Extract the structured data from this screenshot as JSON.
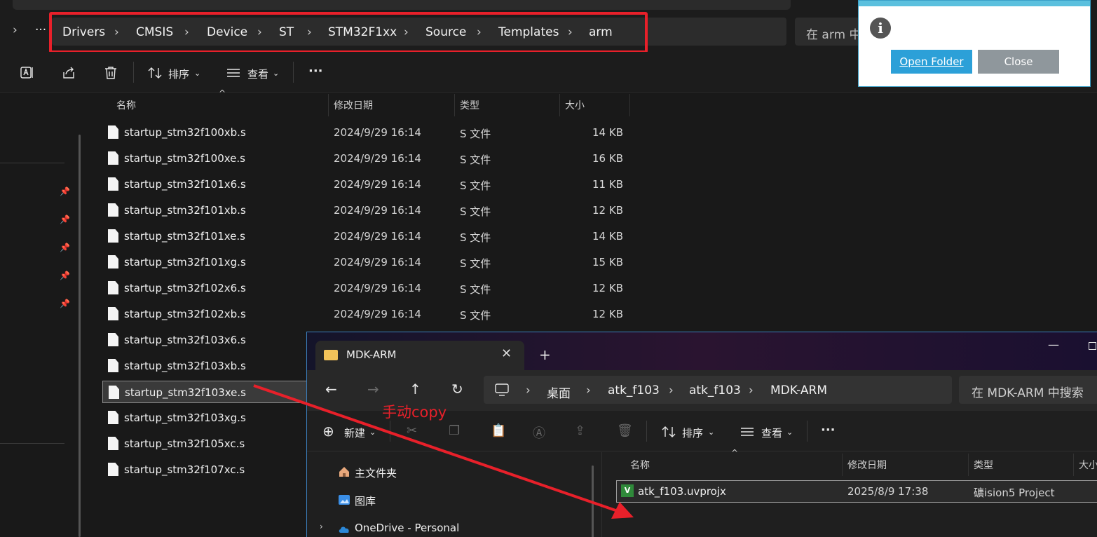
{
  "back_window": {
    "breadcrumb": [
      "Drivers",
      "CMSIS",
      "Device",
      "ST",
      "STM32F1xx",
      "Source",
      "Templates",
      "arm"
    ],
    "overflow_label": "···",
    "search_placeholder": "在 arm 中",
    "toolbar": {
      "sort_label": "排序",
      "view_label": "查看",
      "more_label": "···"
    },
    "columns": {
      "name": "名称",
      "date": "修改日期",
      "type": "类型",
      "size": "大小"
    },
    "files": [
      {
        "name": "startup_stm32f100xb.s",
        "date": "2024/9/29 16:14",
        "type": "S 文件",
        "size": "14 KB"
      },
      {
        "name": "startup_stm32f100xe.s",
        "date": "2024/9/29 16:14",
        "type": "S 文件",
        "size": "16 KB"
      },
      {
        "name": "startup_stm32f101x6.s",
        "date": "2024/9/29 16:14",
        "type": "S 文件",
        "size": "11 KB"
      },
      {
        "name": "startup_stm32f101xb.s",
        "date": "2024/9/29 16:14",
        "type": "S 文件",
        "size": "12 KB"
      },
      {
        "name": "startup_stm32f101xe.s",
        "date": "2024/9/29 16:14",
        "type": "S 文件",
        "size": "14 KB"
      },
      {
        "name": "startup_stm32f101xg.s",
        "date": "2024/9/29 16:14",
        "type": "S 文件",
        "size": "15 KB"
      },
      {
        "name": "startup_stm32f102x6.s",
        "date": "2024/9/29 16:14",
        "type": "S 文件",
        "size": "12 KB"
      },
      {
        "name": "startup_stm32f102xb.s",
        "date": "2024/9/29 16:14",
        "type": "S 文件",
        "size": "12 KB"
      },
      {
        "name": "startup_stm32f103x6.s",
        "date": "",
        "type": "",
        "size": ""
      },
      {
        "name": "startup_stm32f103xb.s",
        "date": "",
        "type": "",
        "size": ""
      },
      {
        "name": "startup_stm32f103xe.s",
        "date": "",
        "type": "",
        "size": ""
      },
      {
        "name": "startup_stm32f103xg.s",
        "date": "",
        "type": "",
        "size": ""
      },
      {
        "name": "startup_stm32f105xc.s",
        "date": "",
        "type": "",
        "size": ""
      },
      {
        "name": "startup_stm32f107xc.s",
        "date": "",
        "type": "",
        "size": ""
      }
    ]
  },
  "dialog": {
    "open_label": "Open Folder",
    "close_label": "Close",
    "info_glyph": "i"
  },
  "front_window": {
    "tab_title": "MDK-ARM",
    "tab_close": "✕",
    "new_tab": "+",
    "minimize": "—",
    "breadcrumb": [
      "桌面",
      "atk_f103",
      "atk_f103",
      "MDK-ARM"
    ],
    "search_placeholder": "在 MDK-ARM 中搜索",
    "toolbar": {
      "new_label": "新建",
      "sort_label": "排序",
      "view_label": "查看",
      "more_label": "···"
    },
    "nav_items": [
      "主文件夹",
      "图库",
      "OneDrive - Personal"
    ],
    "columns": {
      "name": "名称",
      "date": "修改日期",
      "type": "类型",
      "size": "大小"
    },
    "files": [
      {
        "name": "atk_f103.uvprojx",
        "date": "2025/8/9 17:38",
        "type": "礦ision5 Project"
      }
    ]
  },
  "annotation": {
    "text": "手动copy",
    "color": "#e8202a"
  },
  "colors": {
    "background": "#191919",
    "highlight_red": "#e8202a",
    "dialog_primary": "#2ca0d8",
    "dialog_secondary": "#8f979c"
  }
}
